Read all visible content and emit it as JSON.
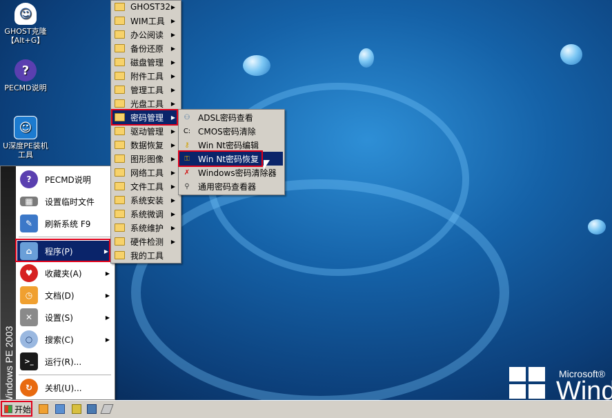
{
  "desktop": {
    "icons": [
      {
        "label_line1": "GHOST克隆",
        "label_line2": "【Alt+G】"
      },
      {
        "label_line1": "PECMD说明",
        "label_line2": ""
      },
      {
        "label_line1": "U深度PE装机",
        "label_line2": "工具"
      }
    ],
    "brand_small": "Microsoft®",
    "brand_large": "Wind"
  },
  "start_menu": {
    "band_text": "Windows PE 2003",
    "items": [
      {
        "label": "PECMD说明",
        "icon": "help-icon",
        "arrow": false
      },
      {
        "label": "设置临时文件",
        "icon": "memory-chip-icon",
        "arrow": false
      },
      {
        "label": "刷新系统 F9",
        "icon": "paint-brush-icon",
        "arrow": false
      },
      {
        "label": "程序(P)",
        "icon": "folder-programs-icon",
        "arrow": true
      },
      {
        "label": "收藏夹(A)",
        "icon": "heart-icon",
        "arrow": true
      },
      {
        "label": "文档(D)",
        "icon": "documents-icon",
        "arrow": true
      },
      {
        "label": "设置(S)",
        "icon": "settings-tools-icon",
        "arrow": true
      },
      {
        "label": "搜索(C)",
        "icon": "search-icon",
        "arrow": true
      },
      {
        "label": "运行(R)...",
        "icon": "run-icon",
        "arrow": false
      },
      {
        "label": "关机(U)...",
        "icon": "shutdown-icon",
        "arrow": false
      }
    ]
  },
  "programs_menu": {
    "items": [
      "GHOST32",
      "WIM工具",
      "办公阅读",
      "备份还原",
      "磁盘管理",
      "附件工具",
      "管理工具",
      "光盘工具",
      "密码管理",
      "驱动管理",
      "数据恢复",
      "图形图像",
      "网络工具",
      "文件工具",
      "系统安装",
      "系统微调",
      "系统维护",
      "硬件检测",
      "我的工具"
    ]
  },
  "password_menu": {
    "items": [
      "ADSL密码查看",
      "CMOS密码清除",
      "Win Nt密码编辑",
      "Win Nt密码恢复",
      "Windows密码清除器",
      "通用密码查看器"
    ]
  },
  "taskbar": {
    "start_label": "开始"
  },
  "colors": {
    "highlight": "#0a246a",
    "annotation_red": "#e0001a",
    "menu_gray": "#d4d0c8"
  }
}
